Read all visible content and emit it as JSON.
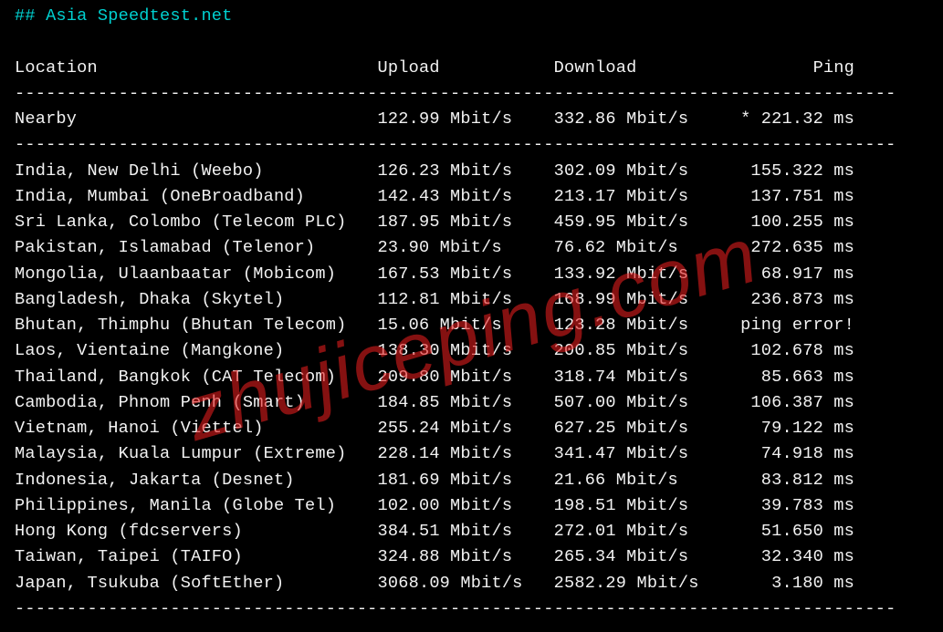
{
  "title_prefix": "## ",
  "title": "Asia Speedtest.net",
  "headers": {
    "location": "Location",
    "upload": "Upload",
    "download": "Download",
    "ping": "Ping"
  },
  "nearby": {
    "location": "Nearby",
    "upload": "122.99 Mbit/s",
    "download": "332.86 Mbit/s",
    "ping": "* 221.32 ms"
  },
  "rows": [
    {
      "location": "India, New Delhi (Weebo)",
      "upload": "126.23 Mbit/s",
      "download": "302.09 Mbit/s",
      "ping": "155.322 ms"
    },
    {
      "location": "India, Mumbai (OneBroadband)",
      "upload": "142.43 Mbit/s",
      "download": "213.17 Mbit/s",
      "ping": "137.751 ms"
    },
    {
      "location": "Sri Lanka, Colombo (Telecom PLC)",
      "upload": "187.95 Mbit/s",
      "download": "459.95 Mbit/s",
      "ping": "100.255 ms"
    },
    {
      "location": "Pakistan, Islamabad (Telenor)",
      "upload": "23.90 Mbit/s",
      "download": "76.62 Mbit/s",
      "ping": "272.635 ms"
    },
    {
      "location": "Mongolia, Ulaanbaatar (Mobicom)",
      "upload": "167.53 Mbit/s",
      "download": "133.92 Mbit/s",
      "ping": "68.917 ms"
    },
    {
      "location": "Bangladesh, Dhaka (Skytel)",
      "upload": "112.81 Mbit/s",
      "download": "168.99 Mbit/s",
      "ping": "236.873 ms"
    },
    {
      "location": "Bhutan, Thimphu (Bhutan Telecom)",
      "upload": "15.06 Mbit/s",
      "download": "123.28 Mbit/s",
      "ping": "ping error!"
    },
    {
      "location": "Laos, Vientaine (Mangkone)",
      "upload": "138.30 Mbit/s",
      "download": "200.85 Mbit/s",
      "ping": "102.678 ms"
    },
    {
      "location": "Thailand, Bangkok (CAT Telecom)",
      "upload": "209.80 Mbit/s",
      "download": "318.74 Mbit/s",
      "ping": "85.663 ms"
    },
    {
      "location": "Cambodia, Phnom Penh (Smart)",
      "upload": "184.85 Mbit/s",
      "download": "507.00 Mbit/s",
      "ping": "106.387 ms"
    },
    {
      "location": "Vietnam, Hanoi (Viettel)",
      "upload": "255.24 Mbit/s",
      "download": "627.25 Mbit/s",
      "ping": "79.122 ms"
    },
    {
      "location": "Malaysia, Kuala Lumpur (Extreme)",
      "upload": "228.14 Mbit/s",
      "download": "341.47 Mbit/s",
      "ping": "74.918 ms"
    },
    {
      "location": "Indonesia, Jakarta (Desnet)",
      "upload": "181.69 Mbit/s",
      "download": "21.66 Mbit/s",
      "ping": "83.812 ms"
    },
    {
      "location": "Philippines, Manila (Globe Tel)",
      "upload": "102.00 Mbit/s",
      "download": "198.51 Mbit/s",
      "ping": "39.783 ms"
    },
    {
      "location": "Hong Kong (fdcservers)",
      "upload": "384.51 Mbit/s",
      "download": "272.01 Mbit/s",
      "ping": "51.650 ms"
    },
    {
      "location": "Taiwan, Taipei (TAIFO)",
      "upload": "324.88 Mbit/s",
      "download": "265.34 Mbit/s",
      "ping": "32.340 ms"
    },
    {
      "location": "Japan, Tsukuba (SoftEther)",
      "upload": "3068.09 Mbit/s",
      "download": "2582.29 Mbit/s",
      "ping": "3.180 ms"
    }
  ],
  "watermark": "zhujiceping.com",
  "layout": {
    "col_loc": 35,
    "col_up": 17,
    "col_dn": 17,
    "col_ping": 12,
    "sep_width": 85
  }
}
